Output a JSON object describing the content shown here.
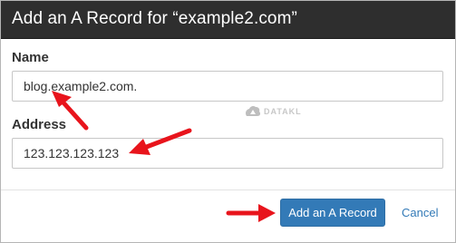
{
  "dialog": {
    "title": "Add an A Record for “example2.com”"
  },
  "form": {
    "name_label": "Name",
    "name_value": "blog.example2.com.",
    "address_label": "Address",
    "address_value": "123.123.123.123"
  },
  "watermark": {
    "text": "DATAKL"
  },
  "actions": {
    "submit_label": "Add an A Record",
    "cancel_label": "Cancel"
  },
  "colors": {
    "header_bg": "#2e2e2e",
    "primary_button": "#337ab7",
    "arrow": "#e8141c"
  }
}
